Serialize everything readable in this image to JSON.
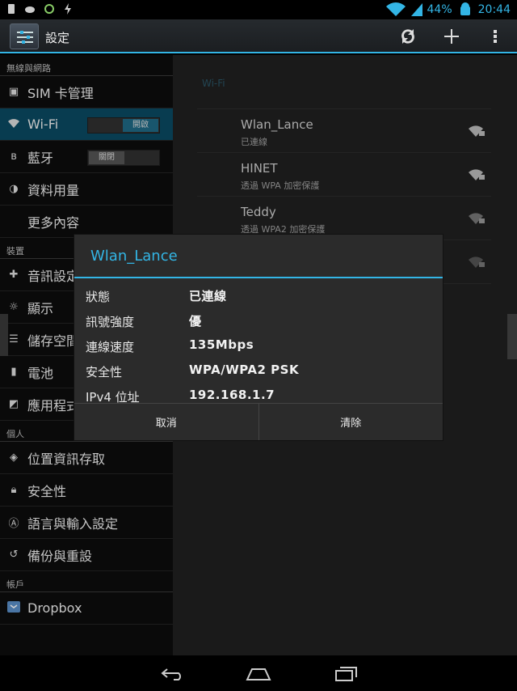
{
  "statusbar": {
    "battery_percent": "44%",
    "time": "20:44"
  },
  "actionbar": {
    "title": "設定",
    "actions": [
      "refresh-icon",
      "add-icon",
      "overflow-icon"
    ]
  },
  "sidebar": {
    "sections": [
      {
        "header": "無線與網路"
      },
      {
        "header": "裝置"
      },
      {
        "header": "個人"
      },
      {
        "header": "帳戶"
      }
    ],
    "items": [
      {
        "label": "SIM 卡管理",
        "icon": "sim-icon"
      },
      {
        "label": "Wi-Fi",
        "icon": "wifi-icon",
        "toggle": "開啟"
      },
      {
        "label": "藍牙",
        "icon": "bluetooth-icon",
        "toggle": "關閉"
      },
      {
        "label": "資料用量",
        "icon": "data-usage-icon"
      },
      {
        "label": "更多內容"
      },
      {
        "label": "音訊設定",
        "icon": "sound-icon"
      },
      {
        "label": "顯示",
        "icon": "display-icon"
      },
      {
        "label": "儲存空間",
        "icon": "storage-icon"
      },
      {
        "label": "電池",
        "icon": "battery-icon"
      },
      {
        "label": "應用程式",
        "icon": "apps-icon"
      },
      {
        "label": "位置資訊存取",
        "icon": "location-icon"
      },
      {
        "label": "安全性",
        "icon": "lock-icon"
      },
      {
        "label": "語言與輸入設定",
        "icon": "language-icon"
      },
      {
        "label": "備份與重設",
        "icon": "backup-icon"
      },
      {
        "label": "Dropbox",
        "icon": "dropbox-icon"
      }
    ]
  },
  "wifi": {
    "header": "Wi-Fi",
    "networks": [
      {
        "name": "Wlan_Lance",
        "status": "已連線"
      },
      {
        "name": "HINET",
        "status": "透過 WPA 加密保護"
      },
      {
        "name": "Teddy",
        "status": "透過 WPA2 加密保護"
      },
      {
        "name": "",
        "status": ""
      }
    ]
  },
  "dialog": {
    "title": "Wlan_Lance",
    "rows": [
      {
        "key": "狀態",
        "value": "已連線"
      },
      {
        "key": "訊號強度",
        "value": "優"
      },
      {
        "key": "連線速度",
        "value": "135Mbps"
      },
      {
        "key": "安全性",
        "value": "WPA/WPA2 PSK"
      },
      {
        "key": "IPv4 位址",
        "value": "192.168.1.7"
      }
    ],
    "cancel_label": "取消",
    "forget_label": "清除"
  },
  "colors": {
    "accent": "#33b5e5",
    "selected_row": "#0a4a62"
  }
}
